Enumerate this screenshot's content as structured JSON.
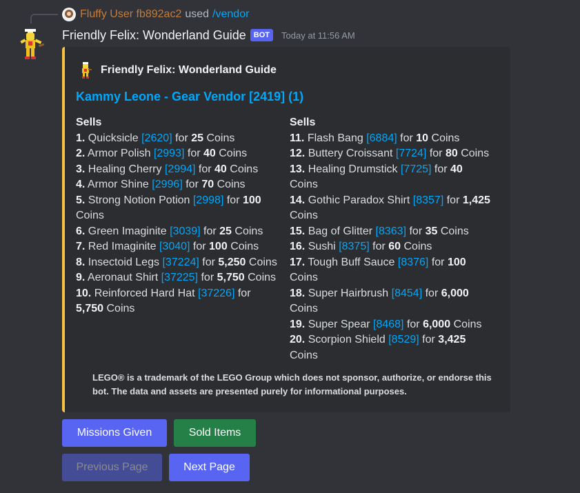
{
  "reply": {
    "user": "Fluffy User fb892ac2",
    "used": "used",
    "command": "/vendor"
  },
  "header": {
    "bot_name": "Friendly Felix: Wonderland Guide",
    "bot_tag": "BOT",
    "timestamp": "Today at 11:56 AM"
  },
  "embed": {
    "accent_color": "#f5c542",
    "author": "Friendly Felix: Wonderland Guide",
    "title": "Kammy Leone - Gear Vendor [2419] (1)",
    "left_heading": "Sells",
    "right_heading": "Sells",
    "for_word": "for",
    "coins_word": "Coins",
    "left_items": [
      {
        "num": "1.",
        "name": "Quicksicle",
        "id": "[2620]",
        "price": "25"
      },
      {
        "num": "2.",
        "name": "Armor Polish",
        "id": "[2993]",
        "price": "40"
      },
      {
        "num": "3.",
        "name": "Healing Cherry",
        "id": "[2994]",
        "price": "40"
      },
      {
        "num": "4.",
        "name": "Armor Shine",
        "id": "[2996]",
        "price": "70"
      },
      {
        "num": "5.",
        "name": "Strong Notion Potion",
        "id": "[2998]",
        "price": "100"
      },
      {
        "num": "6.",
        "name": "Green Imaginite",
        "id": "[3039]",
        "price": "25"
      },
      {
        "num": "7.",
        "name": "Red Imaginite",
        "id": "[3040]",
        "price": "100"
      },
      {
        "num": "8.",
        "name": "Insectoid Legs",
        "id": "[37224]",
        "price": "5,250"
      },
      {
        "num": "9.",
        "name": "Aeronaut Shirt",
        "id": "[37225]",
        "price": "5,750"
      },
      {
        "num": "10.",
        "name": "Reinforced Hard Hat",
        "id": "[37226]",
        "price": "5,750"
      }
    ],
    "right_items": [
      {
        "num": "11.",
        "name": "Flash Bang",
        "id": "[6884]",
        "price": "10"
      },
      {
        "num": "12.",
        "name": "Buttery Croissant",
        "id": "[7724]",
        "price": "80"
      },
      {
        "num": "13.",
        "name": "Healing Drumstick",
        "id": "[7725]",
        "price": "40"
      },
      {
        "num": "14.",
        "name": "Gothic Paradox Shirt",
        "id": "[8357]",
        "price": "1,425"
      },
      {
        "num": "15.",
        "name": "Bag of Glitter",
        "id": "[8363]",
        "price": "35"
      },
      {
        "num": "16.",
        "name": "Sushi",
        "id": "[8375]",
        "price": "60"
      },
      {
        "num": "17.",
        "name": "Tough Buff Sauce",
        "id": "[8376]",
        "price": "100"
      },
      {
        "num": "18.",
        "name": "Super Hairbrush",
        "id": "[8454]",
        "price": "6,000"
      },
      {
        "num": "19.",
        "name": "Super Spear",
        "id": "[8468]",
        "price": "6,000"
      },
      {
        "num": "20.",
        "name": "Scorpion Shield",
        "id": "[8529]",
        "price": "3,425"
      }
    ],
    "disclaimer": "LEGO® is a trademark of the LEGO Group which does not sponsor, authorize, or endorse this bot. The data and assets are presented purely for informational purposes."
  },
  "buttons": {
    "missions": "Missions Given",
    "sold": "Sold Items",
    "previous": "Previous Page",
    "next": "Next Page"
  },
  "icons": {
    "bot_avatar": "minifigure-icon",
    "author_icon": "minifigure-icon",
    "user_avatar": "user-avatar-icon"
  }
}
